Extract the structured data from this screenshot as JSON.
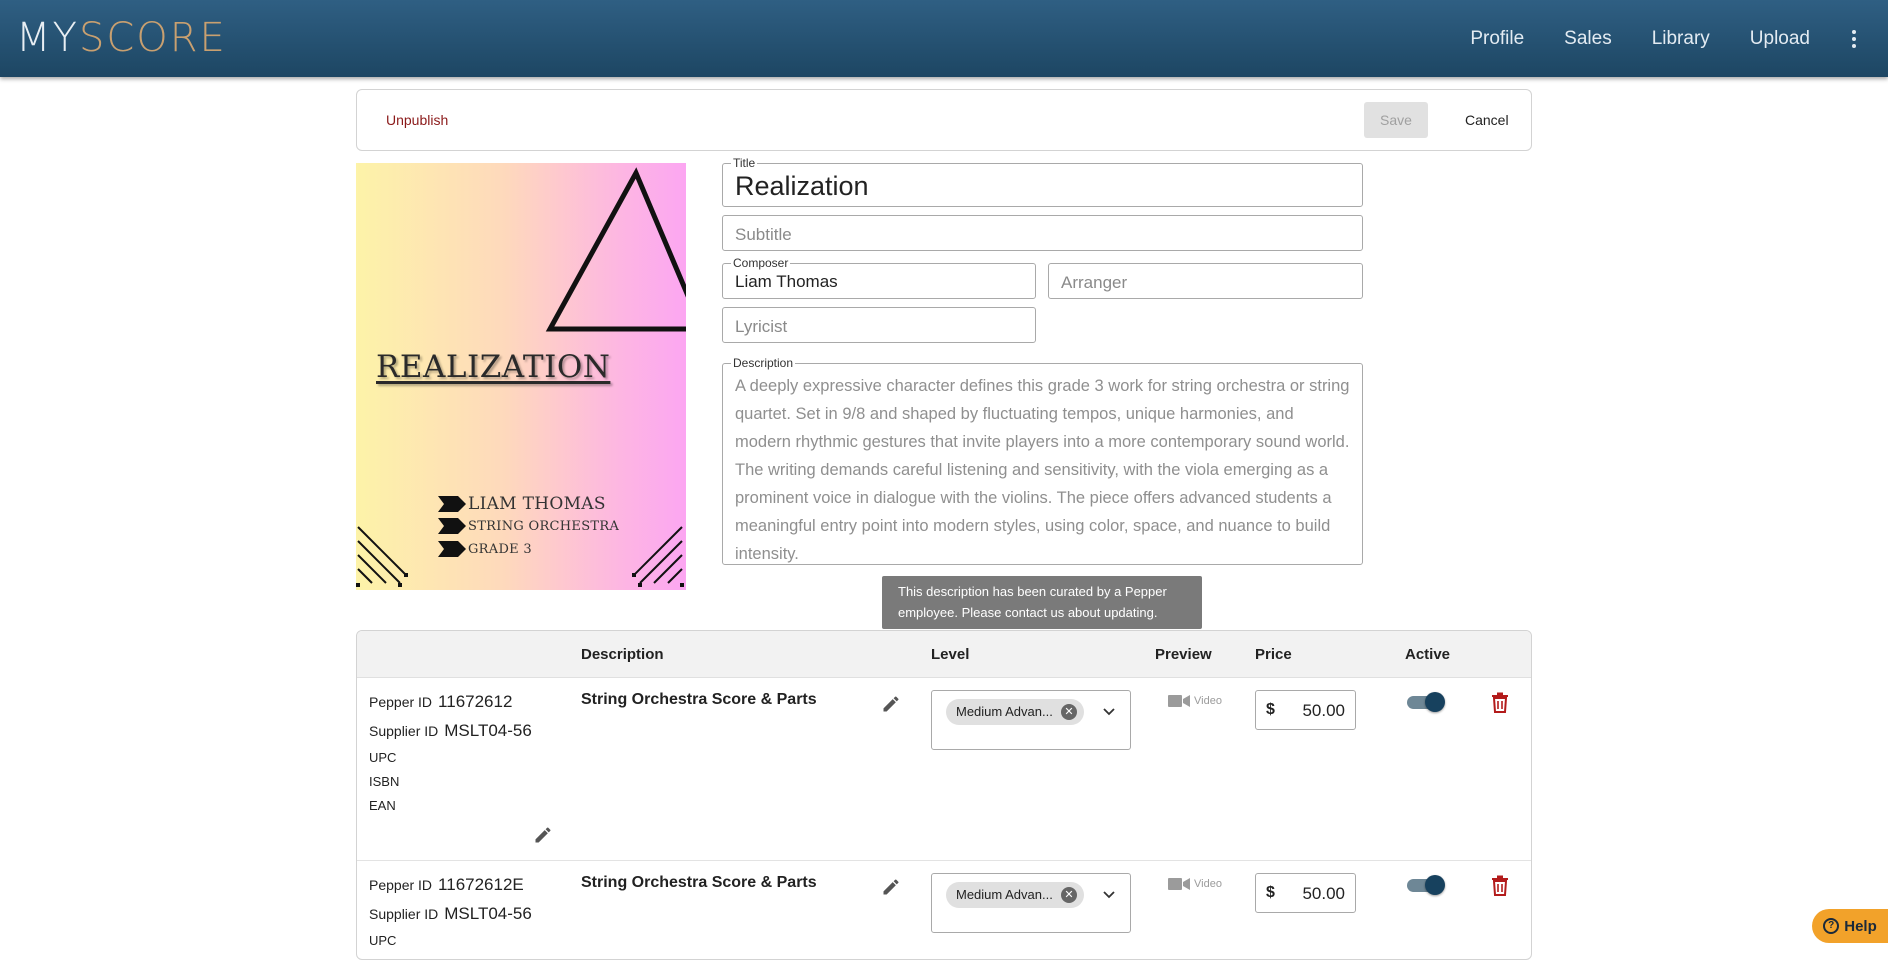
{
  "brand": {
    "logo_part1": "MY",
    "logo_part2": "SCORE"
  },
  "nav": {
    "items": [
      "Profile",
      "Sales",
      "Library",
      "Upload"
    ]
  },
  "actions": {
    "unpublish": "Unpublish",
    "save": "Save",
    "cancel": "Cancel"
  },
  "cover": {
    "title": "REALIZATION",
    "lines": [
      "LIAM THOMAS",
      "STRING ORCHESTRA",
      "GRADE 3"
    ]
  },
  "form": {
    "title_label": "Title",
    "title_value": "Realization",
    "subtitle_placeholder": "Subtitle",
    "composer_label": "Composer",
    "composer_value": "Liam Thomas",
    "arranger_placeholder": "Arranger",
    "lyricist_placeholder": "Lyricist",
    "description_label": "Description",
    "description_value": "A deeply expressive character defines this grade 3 work for string orchestra or string quartet. Set in 9/8 and shaped by fluctuating tempos, unique harmonies, and modern rhythmic gestures that invite players into a more contemporary sound world. The writing demands careful listening and sensitivity, with the viola emerging as a prominent voice in dialogue with the violins. The piece offers advanced students a meaningful entry point into modern styles, using color, space, and nuance to build intensity.",
    "description_tooltip": "This description has been curated by a Pepper employee. Please contact us about updating."
  },
  "table": {
    "headers": {
      "description": "Description",
      "level": "Level",
      "preview": "Preview",
      "price": "Price",
      "active": "Active"
    },
    "labels": {
      "pepper_id": "Pepper ID",
      "supplier_id": "Supplier ID",
      "upc": "UPC",
      "isbn": "ISBN",
      "ean": "EAN",
      "video": "Video",
      "currency": "$"
    },
    "rows": [
      {
        "pepper_id": "11672612",
        "supplier_id": "MSLT04-56",
        "description": "String Orchestra Score & Parts",
        "level": "Medium Advan...",
        "price": "50.00",
        "active": true
      },
      {
        "pepper_id": "11672612E",
        "supplier_id": "MSLT04-56",
        "description": "String Orchestra Score & Parts",
        "level": "Medium Advan...",
        "price": "50.00",
        "active": true
      }
    ]
  },
  "help": {
    "label": "Help"
  },
  "colors": {
    "topbar": "#1d4663",
    "accent_logo": "#c9a070",
    "unpublish": "#8b1a1a",
    "trash": "#b31b1b",
    "toggle_on": "#17415e",
    "help": "#f2a22a"
  }
}
